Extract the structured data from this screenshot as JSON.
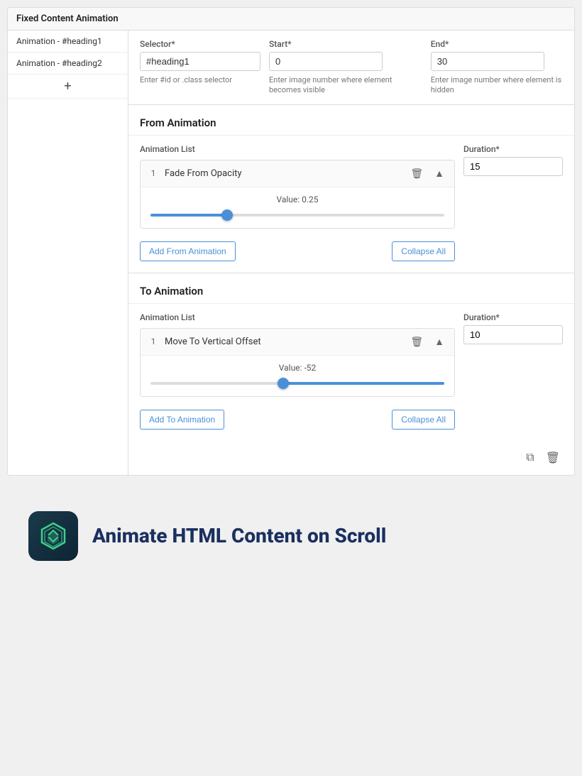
{
  "page": {
    "card_header": "Fixed Content Animation",
    "sidebar": {
      "items": [
        {
          "label": "Animation - #heading1"
        },
        {
          "label": "Animation - #heading2"
        }
      ],
      "add_label": "+"
    },
    "fields": {
      "selector_label": "Selector*",
      "selector_value": "#heading1",
      "selector_hint": "Enter #id or .class selector",
      "start_label": "Start*",
      "start_value": "0",
      "start_hint": "Enter image number where element becomes visible",
      "end_label": "End*",
      "end_value": "30",
      "end_hint": "Enter image number where element is hidden"
    },
    "from_animation": {
      "section_title": "From Animation",
      "list_label": "Animation List",
      "duration_label": "Duration*",
      "duration_value": "15",
      "item_number": "1",
      "item_name": "Fade From Opacity",
      "value_label": "Value:",
      "value": "0.25",
      "slider_value": 25,
      "add_btn": "Add From Animation",
      "collapse_btn": "Collapse All"
    },
    "to_animation": {
      "section_title": "To Animation",
      "list_label": "Animation List",
      "duration_label": "Duration*",
      "duration_value": "10",
      "item_number": "1",
      "item_name": "Move To Vertical Offset",
      "value_label": "Value:",
      "value": "-52",
      "slider_value": 45,
      "add_btn": "Add To Animation",
      "collapse_btn": "Collapse All"
    },
    "branding": {
      "title": "Animate HTML Content on Scroll"
    }
  }
}
